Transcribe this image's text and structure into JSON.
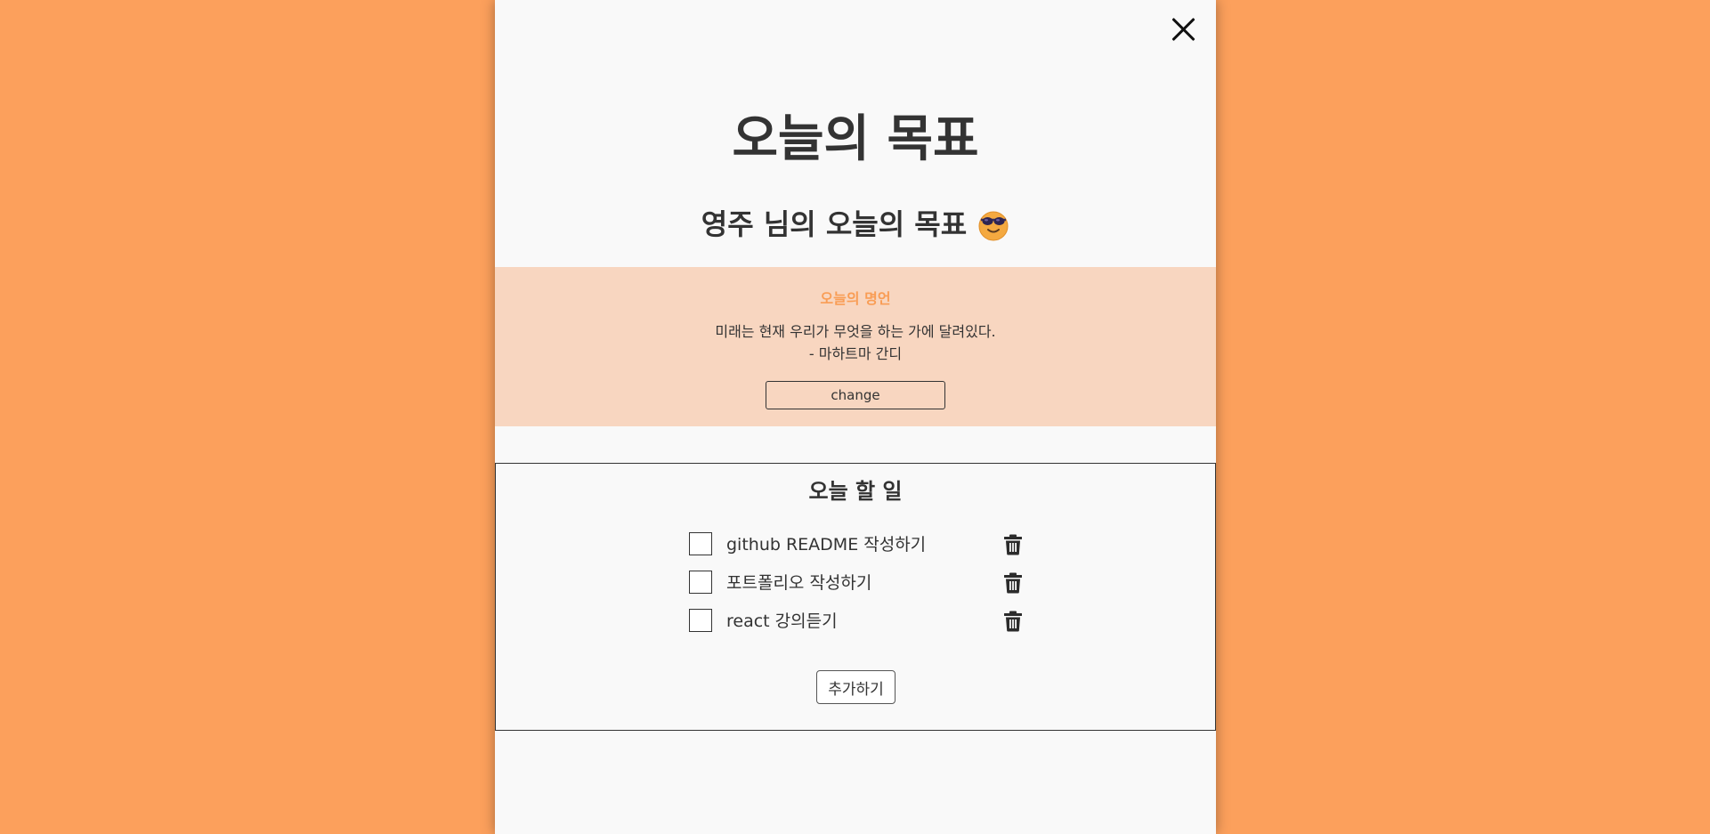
{
  "header": {
    "close_icon": "close-icon",
    "title": "오늘의 목표",
    "subtitle": "영주 님의 오늘의 목표",
    "subtitle_emoji": "smiling-face-with-sunglasses-icon"
  },
  "quote": {
    "label": "오늘의 명언",
    "text": "미래는 현재 우리가 무엇을 하는 가에 달려있다.",
    "author": "- 마하트마 간디",
    "change_label": "change"
  },
  "todo": {
    "title": "오늘 할 일",
    "items": [
      {
        "text": "github README 작성하기",
        "checked": false
      },
      {
        "text": "포트폴리오 작성하기",
        "checked": false
      },
      {
        "text": "react 강의듣기",
        "checked": false
      }
    ],
    "delete_icon": "trash-icon",
    "add_label": "추가하기"
  },
  "colors": {
    "background": "#fca05c",
    "panel": "#f9f9f9",
    "quote_bg": "#f8d6c0",
    "accent": "#f99d55",
    "text": "#333333"
  }
}
